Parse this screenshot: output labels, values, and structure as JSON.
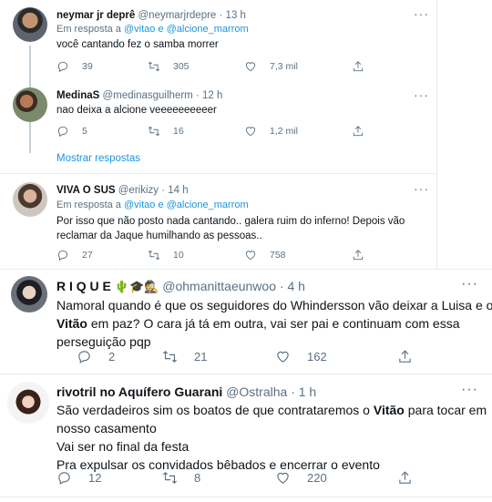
{
  "tweets": [
    {
      "name": "neymar jr deprê",
      "handle": "@neymarjrdepre",
      "time": "· 13 h",
      "reply_prefix": "Em resposta a",
      "reply_to": "@vitao e @alcione_marrom",
      "text": [
        "você cantando fez o samba morrer"
      ],
      "replies": "39",
      "retweets": "305",
      "likes": "7,3 mil"
    },
    {
      "name": "MedinaS",
      "handle": "@medinasguilherm",
      "time": "· 12 h",
      "text": [
        "nao deixa a alcione veeeeeeeeeer"
      ],
      "replies": "5",
      "retweets": "16",
      "likes": "1,2 mil"
    },
    {
      "name": "VIVA O SUS",
      "handle": "@erikizy",
      "time": "· 14 h",
      "reply_prefix": "Em resposta a",
      "reply_to": "@vitao e @alcione_marrom",
      "text": [
        "Por isso que não posto nada cantando..  galera ruim do inferno! Depois vão",
        "reclamar da  Jaque humilhando as pessoas.."
      ],
      "replies": "27",
      "retweets": "10",
      "likes": "758"
    },
    {
      "name": "R I Q U E",
      "name_emoji": "🌵🎓🕵",
      "handle": "@ohmanittaeunwoo",
      "time": "· 4 h",
      "text_runs": [
        [
          "Namoral quando é que os seguidores do Whindersson vão deixar a Luisa e o"
        ],
        [
          "Vitão",
          " em paz? O cara já tá em outra, vai ser pai e continuam com essa"
        ],
        [
          "perseguição pqp"
        ]
      ],
      "replies": "2",
      "retweets": "21",
      "likes": "162"
    },
    {
      "name": "rivotril no Aquífero Guarani",
      "handle": "@Ostralha",
      "time": "· 1 h",
      "text_runs": [
        [
          "São verdadeiros sim os boatos de que contrataremos o ",
          "Vitão",
          " para tocar em"
        ],
        [
          "nosso casamento"
        ],
        [
          "Vai ser no final da festa"
        ],
        [
          "Pra expulsar os convidados bêbados e encerrar o evento"
        ]
      ],
      "replies": "12",
      "retweets": "8",
      "likes": "220"
    }
  ],
  "show_replies": "Mostrar respostas",
  "icons": {
    "reply": "reply-icon",
    "retweet": "retweet-icon",
    "like": "heart-icon",
    "share": "share-icon",
    "more": "more-icon"
  },
  "colors": {
    "link": "#1b95e0",
    "muted": "#5b7083",
    "text": "#0f1419"
  }
}
